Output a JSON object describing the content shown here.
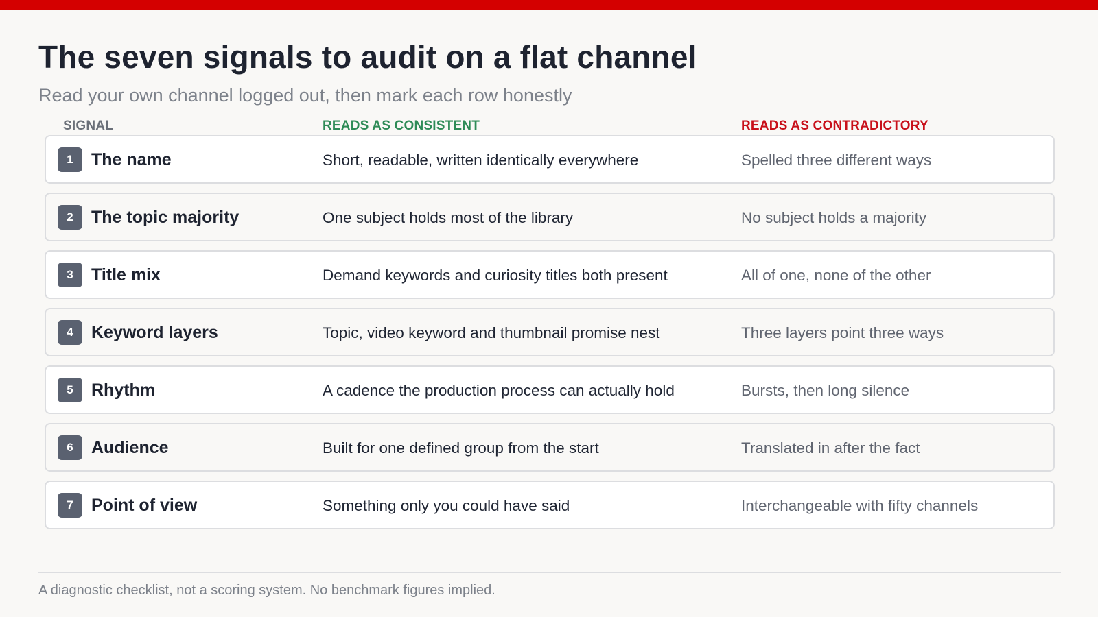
{
  "title": "The seven signals to audit on a flat channel",
  "subtitle": "Read your own channel logged out, then mark each row honestly",
  "columns": {
    "signal": "SIGNAL",
    "consistent": "READS AS CONSISTENT",
    "contradictory": "READS AS CONTRADICTORY"
  },
  "colors": {
    "accent_bar": "#d40000",
    "consistent_header": "#2e8b57",
    "contradictory_header": "#c8101a",
    "badge": "#5a6170"
  },
  "rows": [
    {
      "number": "1",
      "signal": "The name",
      "consistent": "Short, readable, written identically everywhere",
      "contradictory": "Spelled three different ways"
    },
    {
      "number": "2",
      "signal": "The topic majority",
      "consistent": "One subject holds most of the library",
      "contradictory": "No subject holds a majority"
    },
    {
      "number": "3",
      "signal": "Title mix",
      "consistent": "Demand keywords and curiosity titles both present",
      "contradictory": "All of one, none of the other"
    },
    {
      "number": "4",
      "signal": "Keyword layers",
      "consistent": "Topic, video keyword and thumbnail promise nest",
      "contradictory": "Three layers point three ways"
    },
    {
      "number": "5",
      "signal": "Rhythm",
      "consistent": "A cadence the production process can actually hold",
      "contradictory": "Bursts, then long silence"
    },
    {
      "number": "6",
      "signal": "Audience",
      "consistent": "Built for one defined group from the start",
      "contradictory": "Translated in after the fact"
    },
    {
      "number": "7",
      "signal": "Point of view",
      "consistent": "Something only you could have said",
      "contradictory": "Interchangeable with fifty channels"
    }
  ],
  "footnote": "A diagnostic checklist, not a scoring system. No benchmark figures implied."
}
